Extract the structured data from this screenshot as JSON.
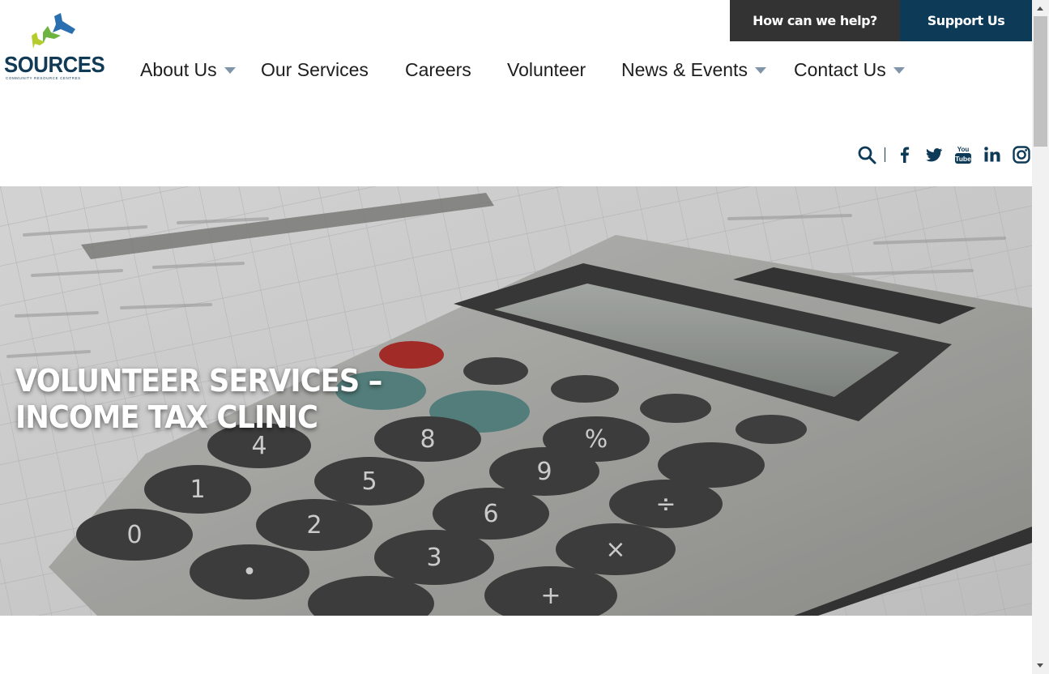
{
  "utility": {
    "help_label": "How can we help?",
    "support_label": "Support Us"
  },
  "logo": {
    "wordmark": "SOURCES",
    "tagline": "COMMUNITY RESOURCE CENTRES"
  },
  "nav": {
    "items": [
      {
        "label": "About Us",
        "has_dropdown": true
      },
      {
        "label": "Our Services",
        "has_dropdown": false
      },
      {
        "label": "Careers",
        "has_dropdown": false
      },
      {
        "label": "Volunteer",
        "has_dropdown": false
      },
      {
        "label": "News & Events",
        "has_dropdown": true
      },
      {
        "label": "Contact Us",
        "has_dropdown": true
      }
    ]
  },
  "social": {
    "icons": [
      "search-icon",
      "facebook-icon",
      "twitter-icon",
      "youtube-icon",
      "linkedin-icon",
      "instagram-icon"
    ]
  },
  "hero": {
    "title_line1": "VOLUNTEER SERVICES –",
    "title_line2": "INCOME TAX CLINIC",
    "background": "calculator-photo"
  },
  "colors": {
    "brand_navy": "#0d3a57",
    "utility_dark": "#333333",
    "nav_text": "#1e1e1e",
    "caret": "#7f95aa",
    "logo_blue": "#2a6fb0",
    "logo_green": "#6cb33f",
    "logo_lime": "#b5cc2e"
  }
}
